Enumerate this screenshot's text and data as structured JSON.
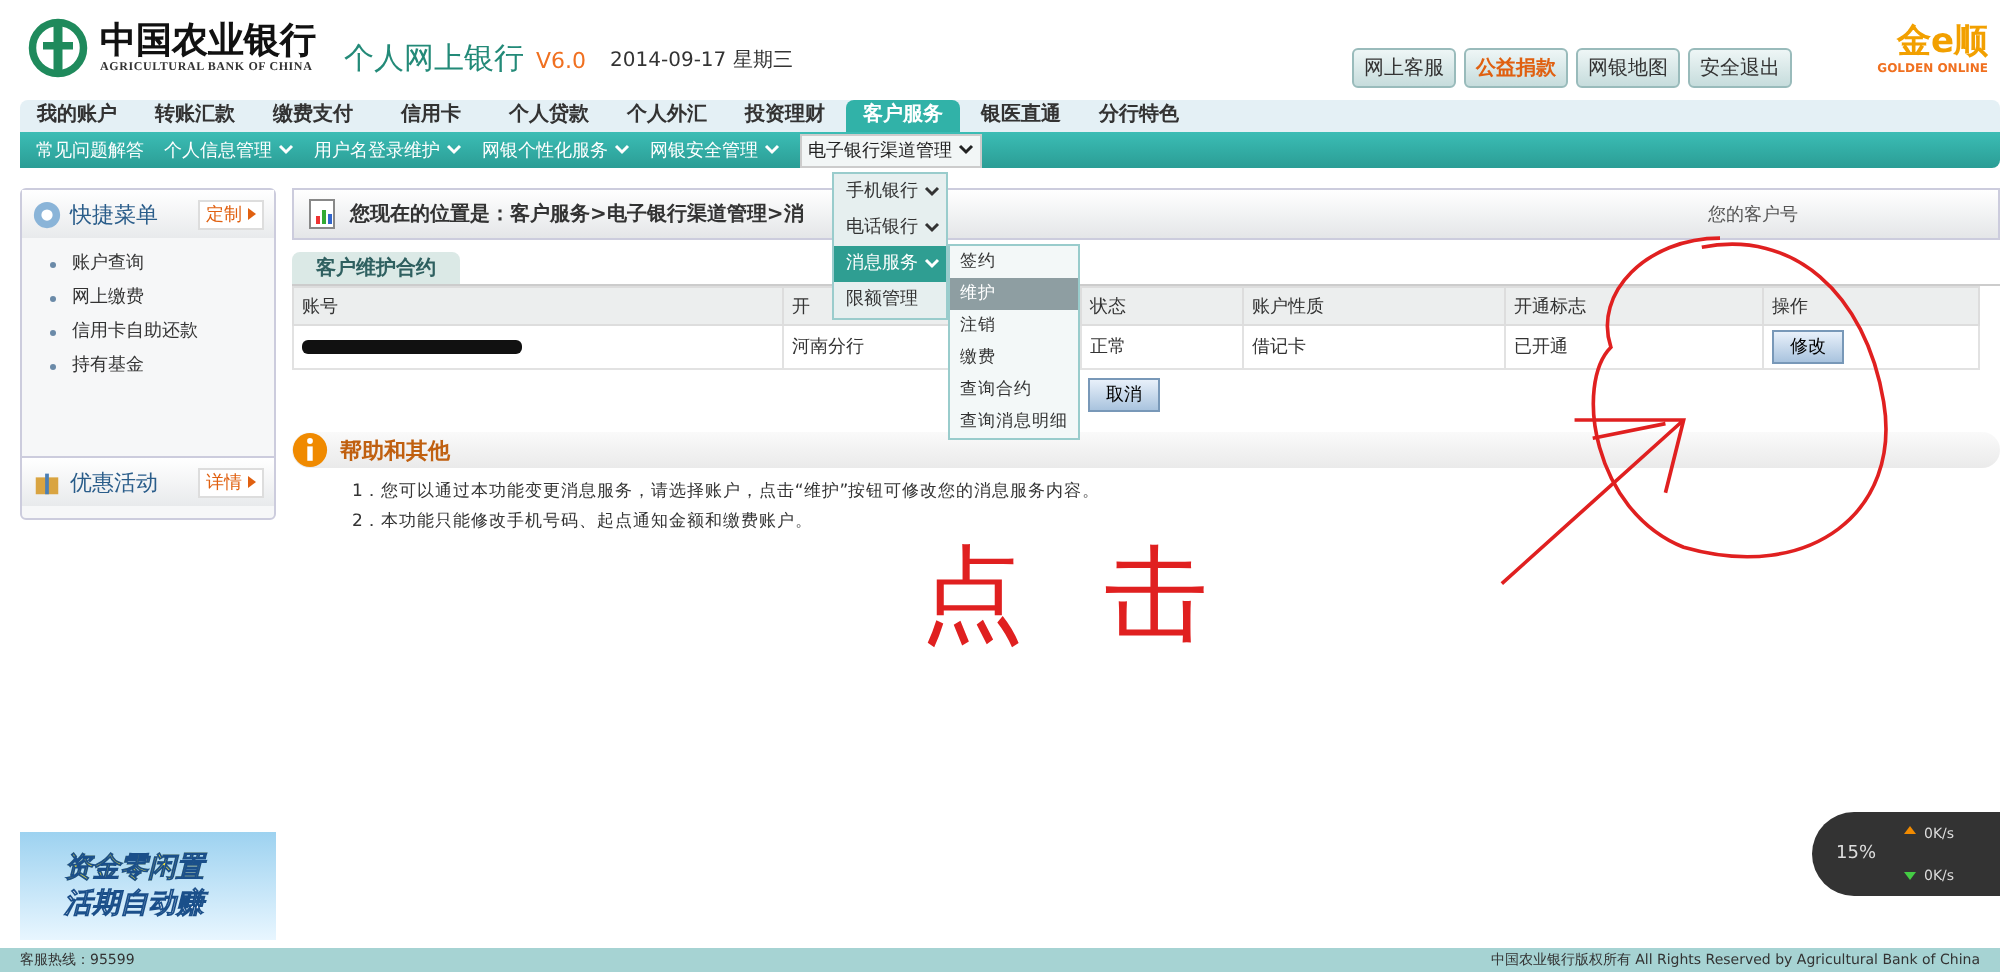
{
  "header": {
    "bank_name": "中国农业银行",
    "bank_name_en": "AGRICULTURAL BANK OF CHINA",
    "product": "个人网上银行",
    "version": "V6.0",
    "date": "2014-09-17 星期三",
    "top_buttons": [
      {
        "label": "网上客服",
        "highlight": false
      },
      {
        "label": "公益捐款",
        "highlight": true
      },
      {
        "label": "网银地图",
        "highlight": false
      },
      {
        "label": "安全退出",
        "highlight": false
      }
    ],
    "brand": "金e顺",
    "brand_en": "GOLDEN ONLINE"
  },
  "main_nav": [
    {
      "label": "我的账户",
      "selected": false
    },
    {
      "label": "转账汇款",
      "selected": false
    },
    {
      "label": "缴费支付",
      "selected": false
    },
    {
      "label": "信用卡",
      "selected": false
    },
    {
      "label": "个人贷款",
      "selected": false
    },
    {
      "label": "个人外汇",
      "selected": false
    },
    {
      "label": "投资理财",
      "selected": false
    },
    {
      "label": "客户服务",
      "selected": true
    },
    {
      "label": "银医直通",
      "selected": false
    },
    {
      "label": "分行特色",
      "selected": false
    }
  ],
  "sub_nav": [
    {
      "label": "常见问题解答",
      "has_menu": false,
      "selected": false
    },
    {
      "label": "个人信息管理",
      "has_menu": true,
      "selected": false
    },
    {
      "label": "用户名登录维护",
      "has_menu": true,
      "selected": false
    },
    {
      "label": "网银个性化服务",
      "has_menu": true,
      "selected": false
    },
    {
      "label": "网银安全管理",
      "has_menu": true,
      "selected": false
    },
    {
      "label": "电子银行渠道管理",
      "has_menu": true,
      "selected": true
    }
  ],
  "dropdown": [
    {
      "label": "手机银行",
      "has_menu": true,
      "selected": false
    },
    {
      "label": "电话银行",
      "has_menu": true,
      "selected": false
    },
    {
      "label": "消息服务",
      "has_menu": true,
      "selected": true
    },
    {
      "label": "限额管理",
      "has_menu": false,
      "selected": false
    }
  ],
  "submenu": [
    {
      "label": "签约",
      "selected": false
    },
    {
      "label": "维护",
      "selected": true
    },
    {
      "label": "注销",
      "selected": false
    },
    {
      "label": "缴费",
      "selected": false
    },
    {
      "label": "查询合约",
      "selected": false
    },
    {
      "label": "查询消息明细",
      "selected": false
    }
  ],
  "sidebar": {
    "quick_menu": {
      "title": "快捷菜单",
      "action": "定制",
      "items": [
        "账户查询",
        "网上缴费",
        "信用卡自助还款",
        "持有基金"
      ]
    },
    "promo": {
      "title": "优惠活动",
      "action": "详情"
    },
    "banner": {
      "line1": "资金零闲置",
      "line2": "活期自动赚"
    }
  },
  "breadcrumb": "您现在的位置是：客户服务>电子银行渠道管理>消",
  "customer_label": "您的客户号",
  "tab": "客户维护合约",
  "table": {
    "columns": [
      "账号",
      "开",
      "状态",
      "账户性质",
      "开通标志",
      "操作"
    ],
    "rows": [
      {
        "branch": "河南分行",
        "status": "正常",
        "type": "借记卡",
        "opened": "已开通",
        "action": "修改"
      }
    ]
  },
  "cancel_button": "取消",
  "help": {
    "title": "帮助和其他",
    "items": [
      "1．您可以通过本功能变更消息服务，请选择账户，点击“维护”按钮可修改您的消息服务内容。",
      "2．本功能只能修改手机号码、起点通知金额和缴费账户。"
    ]
  },
  "annotation": "点击",
  "speed_widget": {
    "percent": "15%",
    "up": "0K/s",
    "down": "0K/s"
  },
  "footer": {
    "hotline": "客服热线：95599",
    "copyright": "中国农业银行版权所有 All Rights Reserved by Agricultural Bank of China"
  }
}
